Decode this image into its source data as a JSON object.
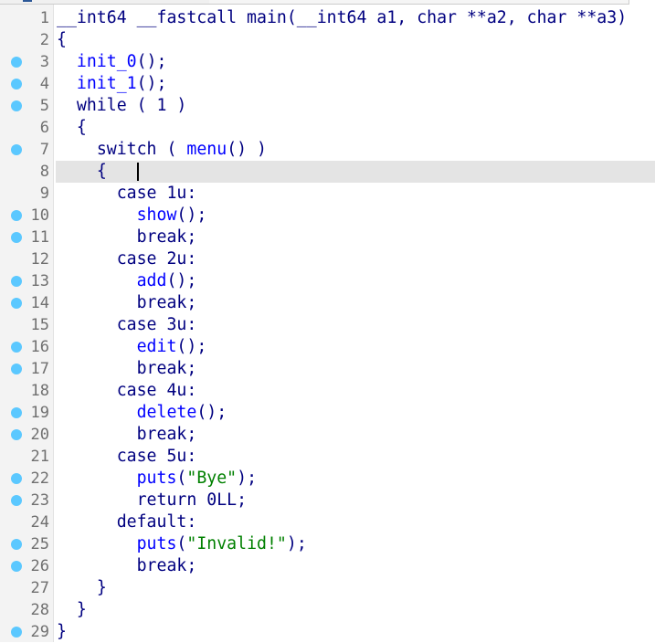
{
  "colors": {
    "keyword": "#000080",
    "function": "#0000ff",
    "string": "#008000",
    "breakpoint_dot": "#5bc8ff",
    "current_line": "#e4e4e4"
  },
  "current_line": 8,
  "lines": [
    {
      "n": "1",
      "dot": false,
      "indent": 0,
      "tokens": [
        [
          "kw",
          "__int64 __fastcall main(__int64 a1, char **a2, char **a3)"
        ]
      ]
    },
    {
      "n": "2",
      "dot": false,
      "indent": 0,
      "tokens": [
        [
          "kw",
          "{"
        ]
      ]
    },
    {
      "n": "3",
      "dot": true,
      "indent": 2,
      "tokens": [
        [
          "fn",
          "init_0"
        ],
        [
          "kw",
          "();"
        ]
      ]
    },
    {
      "n": "4",
      "dot": true,
      "indent": 2,
      "tokens": [
        [
          "fn",
          "init_1"
        ],
        [
          "kw",
          "();"
        ]
      ]
    },
    {
      "n": "5",
      "dot": true,
      "indent": 2,
      "tokens": [
        [
          "kw",
          "while ( 1 )"
        ]
      ]
    },
    {
      "n": "6",
      "dot": false,
      "indent": 2,
      "tokens": [
        [
          "kw",
          "{"
        ]
      ]
    },
    {
      "n": "7",
      "dot": true,
      "indent": 4,
      "tokens": [
        [
          "kw",
          "switch ( "
        ],
        [
          "fn",
          "menu"
        ],
        [
          "kw",
          "() )"
        ]
      ]
    },
    {
      "n": "8",
      "dot": false,
      "indent": 4,
      "tokens": [
        [
          "kw",
          "{   "
        ]
      ]
    },
    {
      "n": "9",
      "dot": false,
      "indent": 6,
      "tokens": [
        [
          "kw",
          "case 1u:"
        ]
      ]
    },
    {
      "n": "10",
      "dot": true,
      "indent": 8,
      "tokens": [
        [
          "fn",
          "show"
        ],
        [
          "kw",
          "();"
        ]
      ]
    },
    {
      "n": "11",
      "dot": true,
      "indent": 8,
      "tokens": [
        [
          "kw",
          "break;"
        ]
      ]
    },
    {
      "n": "12",
      "dot": false,
      "indent": 6,
      "tokens": [
        [
          "kw",
          "case 2u:"
        ]
      ]
    },
    {
      "n": "13",
      "dot": true,
      "indent": 8,
      "tokens": [
        [
          "fn",
          "add"
        ],
        [
          "kw",
          "();"
        ]
      ]
    },
    {
      "n": "14",
      "dot": true,
      "indent": 8,
      "tokens": [
        [
          "kw",
          "break;"
        ]
      ]
    },
    {
      "n": "15",
      "dot": false,
      "indent": 6,
      "tokens": [
        [
          "kw",
          "case 3u:"
        ]
      ]
    },
    {
      "n": "16",
      "dot": true,
      "indent": 8,
      "tokens": [
        [
          "fn",
          "edit"
        ],
        [
          "kw",
          "();"
        ]
      ]
    },
    {
      "n": "17",
      "dot": true,
      "indent": 8,
      "tokens": [
        [
          "kw",
          "break;"
        ]
      ]
    },
    {
      "n": "18",
      "dot": false,
      "indent": 6,
      "tokens": [
        [
          "kw",
          "case 4u:"
        ]
      ]
    },
    {
      "n": "19",
      "dot": true,
      "indent": 8,
      "tokens": [
        [
          "fn",
          "delete"
        ],
        [
          "kw",
          "();"
        ]
      ]
    },
    {
      "n": "20",
      "dot": true,
      "indent": 8,
      "tokens": [
        [
          "kw",
          "break;"
        ]
      ]
    },
    {
      "n": "21",
      "dot": false,
      "indent": 6,
      "tokens": [
        [
          "kw",
          "case 5u:"
        ]
      ]
    },
    {
      "n": "22",
      "dot": true,
      "indent": 8,
      "tokens": [
        [
          "fn",
          "puts"
        ],
        [
          "kw",
          "("
        ],
        [
          "str",
          "\"Bye\""
        ],
        [
          "kw",
          ");"
        ]
      ]
    },
    {
      "n": "23",
      "dot": true,
      "indent": 8,
      "tokens": [
        [
          "kw",
          "return 0LL;"
        ]
      ]
    },
    {
      "n": "24",
      "dot": false,
      "indent": 6,
      "tokens": [
        [
          "kw",
          "default:"
        ]
      ]
    },
    {
      "n": "25",
      "dot": true,
      "indent": 8,
      "tokens": [
        [
          "fn",
          "puts"
        ],
        [
          "kw",
          "("
        ],
        [
          "str",
          "\"Invalid!\""
        ],
        [
          "kw",
          ");"
        ]
      ]
    },
    {
      "n": "26",
      "dot": true,
      "indent": 8,
      "tokens": [
        [
          "kw",
          "break;"
        ]
      ]
    },
    {
      "n": "27",
      "dot": false,
      "indent": 4,
      "tokens": [
        [
          "kw",
          "}"
        ]
      ]
    },
    {
      "n": "28",
      "dot": false,
      "indent": 2,
      "tokens": [
        [
          "kw",
          "}"
        ]
      ]
    },
    {
      "n": "29",
      "dot": true,
      "indent": 0,
      "tokens": [
        [
          "kw",
          "}"
        ]
      ]
    }
  ]
}
